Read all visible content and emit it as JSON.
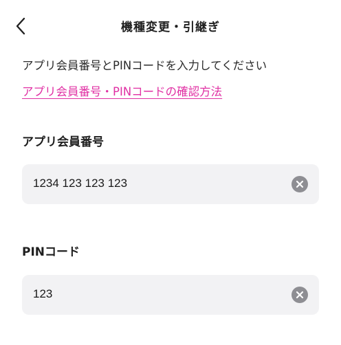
{
  "header": {
    "title": "機種変更・引継ぎ",
    "back_icon": "chevron-left-icon"
  },
  "main": {
    "instruction": "アプリ会員番号とPINコードを入力してください",
    "help_link": "アプリ会員番号・PINコードの確認方法",
    "member_number": {
      "label": "アプリ会員番号",
      "value": "1234 123 123 123",
      "clear_icon": "clear-circle-icon"
    },
    "pin": {
      "label": "PINコード",
      "value": "123",
      "clear_icon": "clear-circle-icon"
    }
  },
  "colors": {
    "link": "#e02fa3",
    "field_background": "#f2f2f4",
    "clear_icon": "#8e8e93"
  }
}
